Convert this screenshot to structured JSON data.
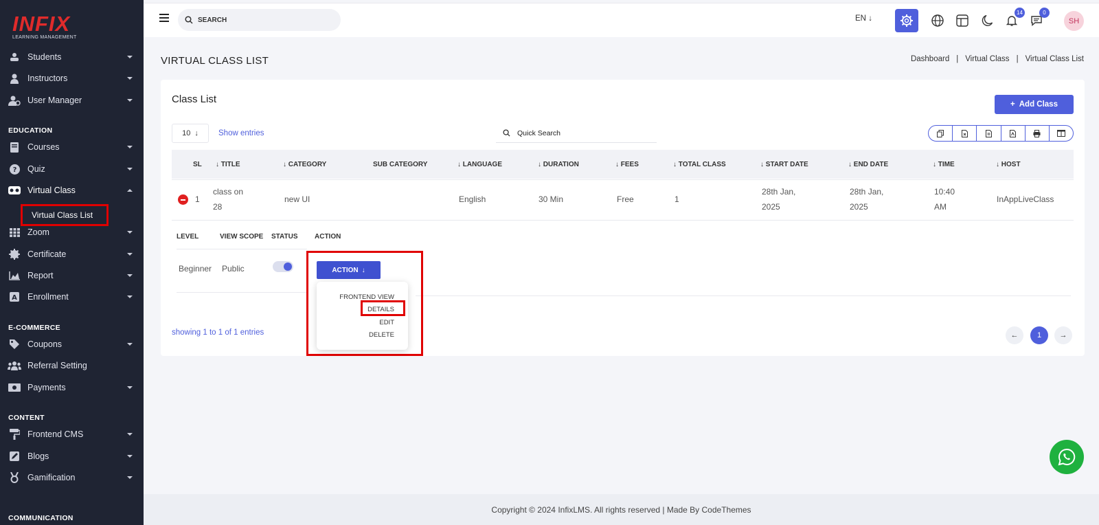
{
  "brand": {
    "name": "INFIX",
    "tagline": "LEARNING MANAGEMENT"
  },
  "sidebar": {
    "items": [
      {
        "label": "Students",
        "icon": "students-icon"
      },
      {
        "label": "Instructors",
        "icon": "instructors-icon"
      },
      {
        "label": "User Manager",
        "icon": "user-manager-icon"
      },
      {
        "label": "Courses",
        "icon": "courses-icon"
      },
      {
        "label": "Quiz",
        "icon": "quiz-icon"
      },
      {
        "label": "Virtual Class",
        "icon": "vr-icon"
      },
      {
        "label": "Zoom",
        "icon": "grid-icon"
      },
      {
        "label": "Certificate",
        "icon": "certificate-icon"
      },
      {
        "label": "Report",
        "icon": "chart-icon"
      },
      {
        "label": "Enrollment",
        "icon": "enrollment-icon"
      },
      {
        "label": "Coupons",
        "icon": "coupon-icon"
      },
      {
        "label": "Referral Setting",
        "icon": "referral-icon"
      },
      {
        "label": "Payments",
        "icon": "payments-icon"
      },
      {
        "label": "Frontend CMS",
        "icon": "paint-roller-icon"
      },
      {
        "label": "Blogs",
        "icon": "blog-icon"
      },
      {
        "label": "Gamification",
        "icon": "medal-icon"
      }
    ],
    "sections": [
      "EDUCATION",
      "E-COMMERCE",
      "CONTENT",
      "COMMUNICATION"
    ],
    "active_sub": "Virtual Class List"
  },
  "topbar": {
    "search_placeholder": "SEARCH",
    "language": "EN",
    "notifications_count": "14",
    "messages_count": "0",
    "avatar_initials": "SH"
  },
  "page": {
    "title": "VIRTUAL CLASS LIST",
    "breadcrumb": [
      "Dashboard",
      "Virtual Class",
      "Virtual Class List"
    ]
  },
  "card": {
    "title": "Class List",
    "add_button": "Add Class",
    "entries_value": "10",
    "show_entries": "Show entries",
    "quick_search_placeholder": "Quick Search"
  },
  "table": {
    "headers": [
      "SL",
      "TITLE",
      "CATEGORY",
      "SUB CATEGORY",
      "LANGUAGE",
      "DURATION",
      "FEES",
      "TOTAL CLASS",
      "START DATE",
      "END DATE",
      "TIME",
      "HOST"
    ],
    "row": {
      "sl": "1",
      "title_line1": "class on",
      "title_line2": "28",
      "category": "new UI",
      "sub_category": "",
      "language": "English",
      "duration": "30 Min",
      "fees": "Free",
      "total_class": "1",
      "start_line1": "28th Jan,",
      "start_line2": "2025",
      "end_line1": "28th Jan,",
      "end_line2": "2025",
      "time_line1": "10:40",
      "time_line2": "AM",
      "host": "InAppLiveClass"
    },
    "sub_headers": [
      "LEVEL",
      "VIEW SCOPE",
      "STATUS",
      "ACTION"
    ],
    "sub_row": {
      "level": "Beginner",
      "view_scope": "Public",
      "status_on": true
    }
  },
  "action_menu": {
    "button": "ACTION",
    "items": [
      "FRONTEND VIEW",
      "DETAILS",
      "EDIT",
      "DELETE"
    ]
  },
  "pagination": {
    "showing": "showing 1 to 1 of 1 entries",
    "current": "1"
  },
  "footer": {
    "text": "Copyright © 2024 InfixLMS. All rights reserved | Made By CodeThemes"
  },
  "colors": {
    "sidebar": "#1f2433",
    "accent": "#4f5fdc",
    "highlight": "#e00000",
    "whatsapp": "#1fb13f"
  }
}
